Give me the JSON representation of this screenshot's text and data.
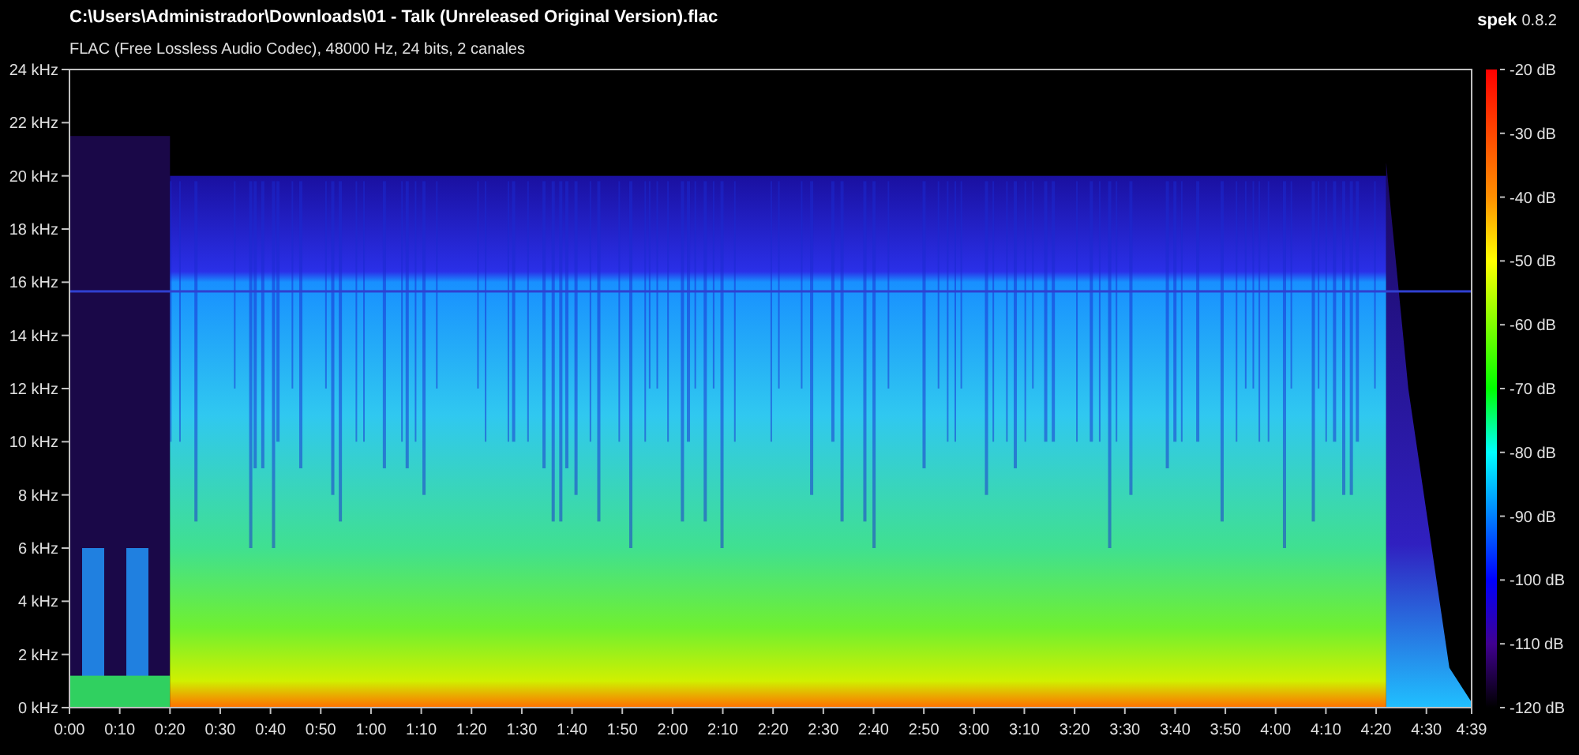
{
  "header": {
    "file_path": "C:\\Users\\Administrador\\Downloads\\01 - Talk (Unreleased Original Version).flac",
    "stream_info": "FLAC (Free Lossless Audio Codec), 48000 Hz, 24 bits, 2 canales",
    "app_name": "spek",
    "app_version": "0.8.2"
  },
  "frequency_axis": [
    "24 kHz",
    "22 kHz",
    "20 kHz",
    "18 kHz",
    "16 kHz",
    "14 kHz",
    "12 kHz",
    "10 kHz",
    "8 kHz",
    "6 kHz",
    "4 kHz",
    "2 kHz",
    "0 kHz"
  ],
  "time_axis": [
    "0:00",
    "0:10",
    "0:20",
    "0:30",
    "0:40",
    "0:50",
    "1:00",
    "1:10",
    "1:20",
    "1:30",
    "1:40",
    "1:50",
    "2:00",
    "2:10",
    "2:20",
    "2:30",
    "2:40",
    "2:50",
    "3:00",
    "3:10",
    "3:20",
    "3:30",
    "3:40",
    "3:50",
    "4:00",
    "4:10",
    "4:20",
    "4:30",
    "4:39"
  ],
  "level_scale": [
    "-20 dB",
    "-30 dB",
    "-40 dB",
    "-50 dB",
    "-60 dB",
    "-70 dB",
    "-80 dB",
    "-90 dB",
    "-100 dB",
    "-110 dB",
    "-120 dB"
  ]
}
